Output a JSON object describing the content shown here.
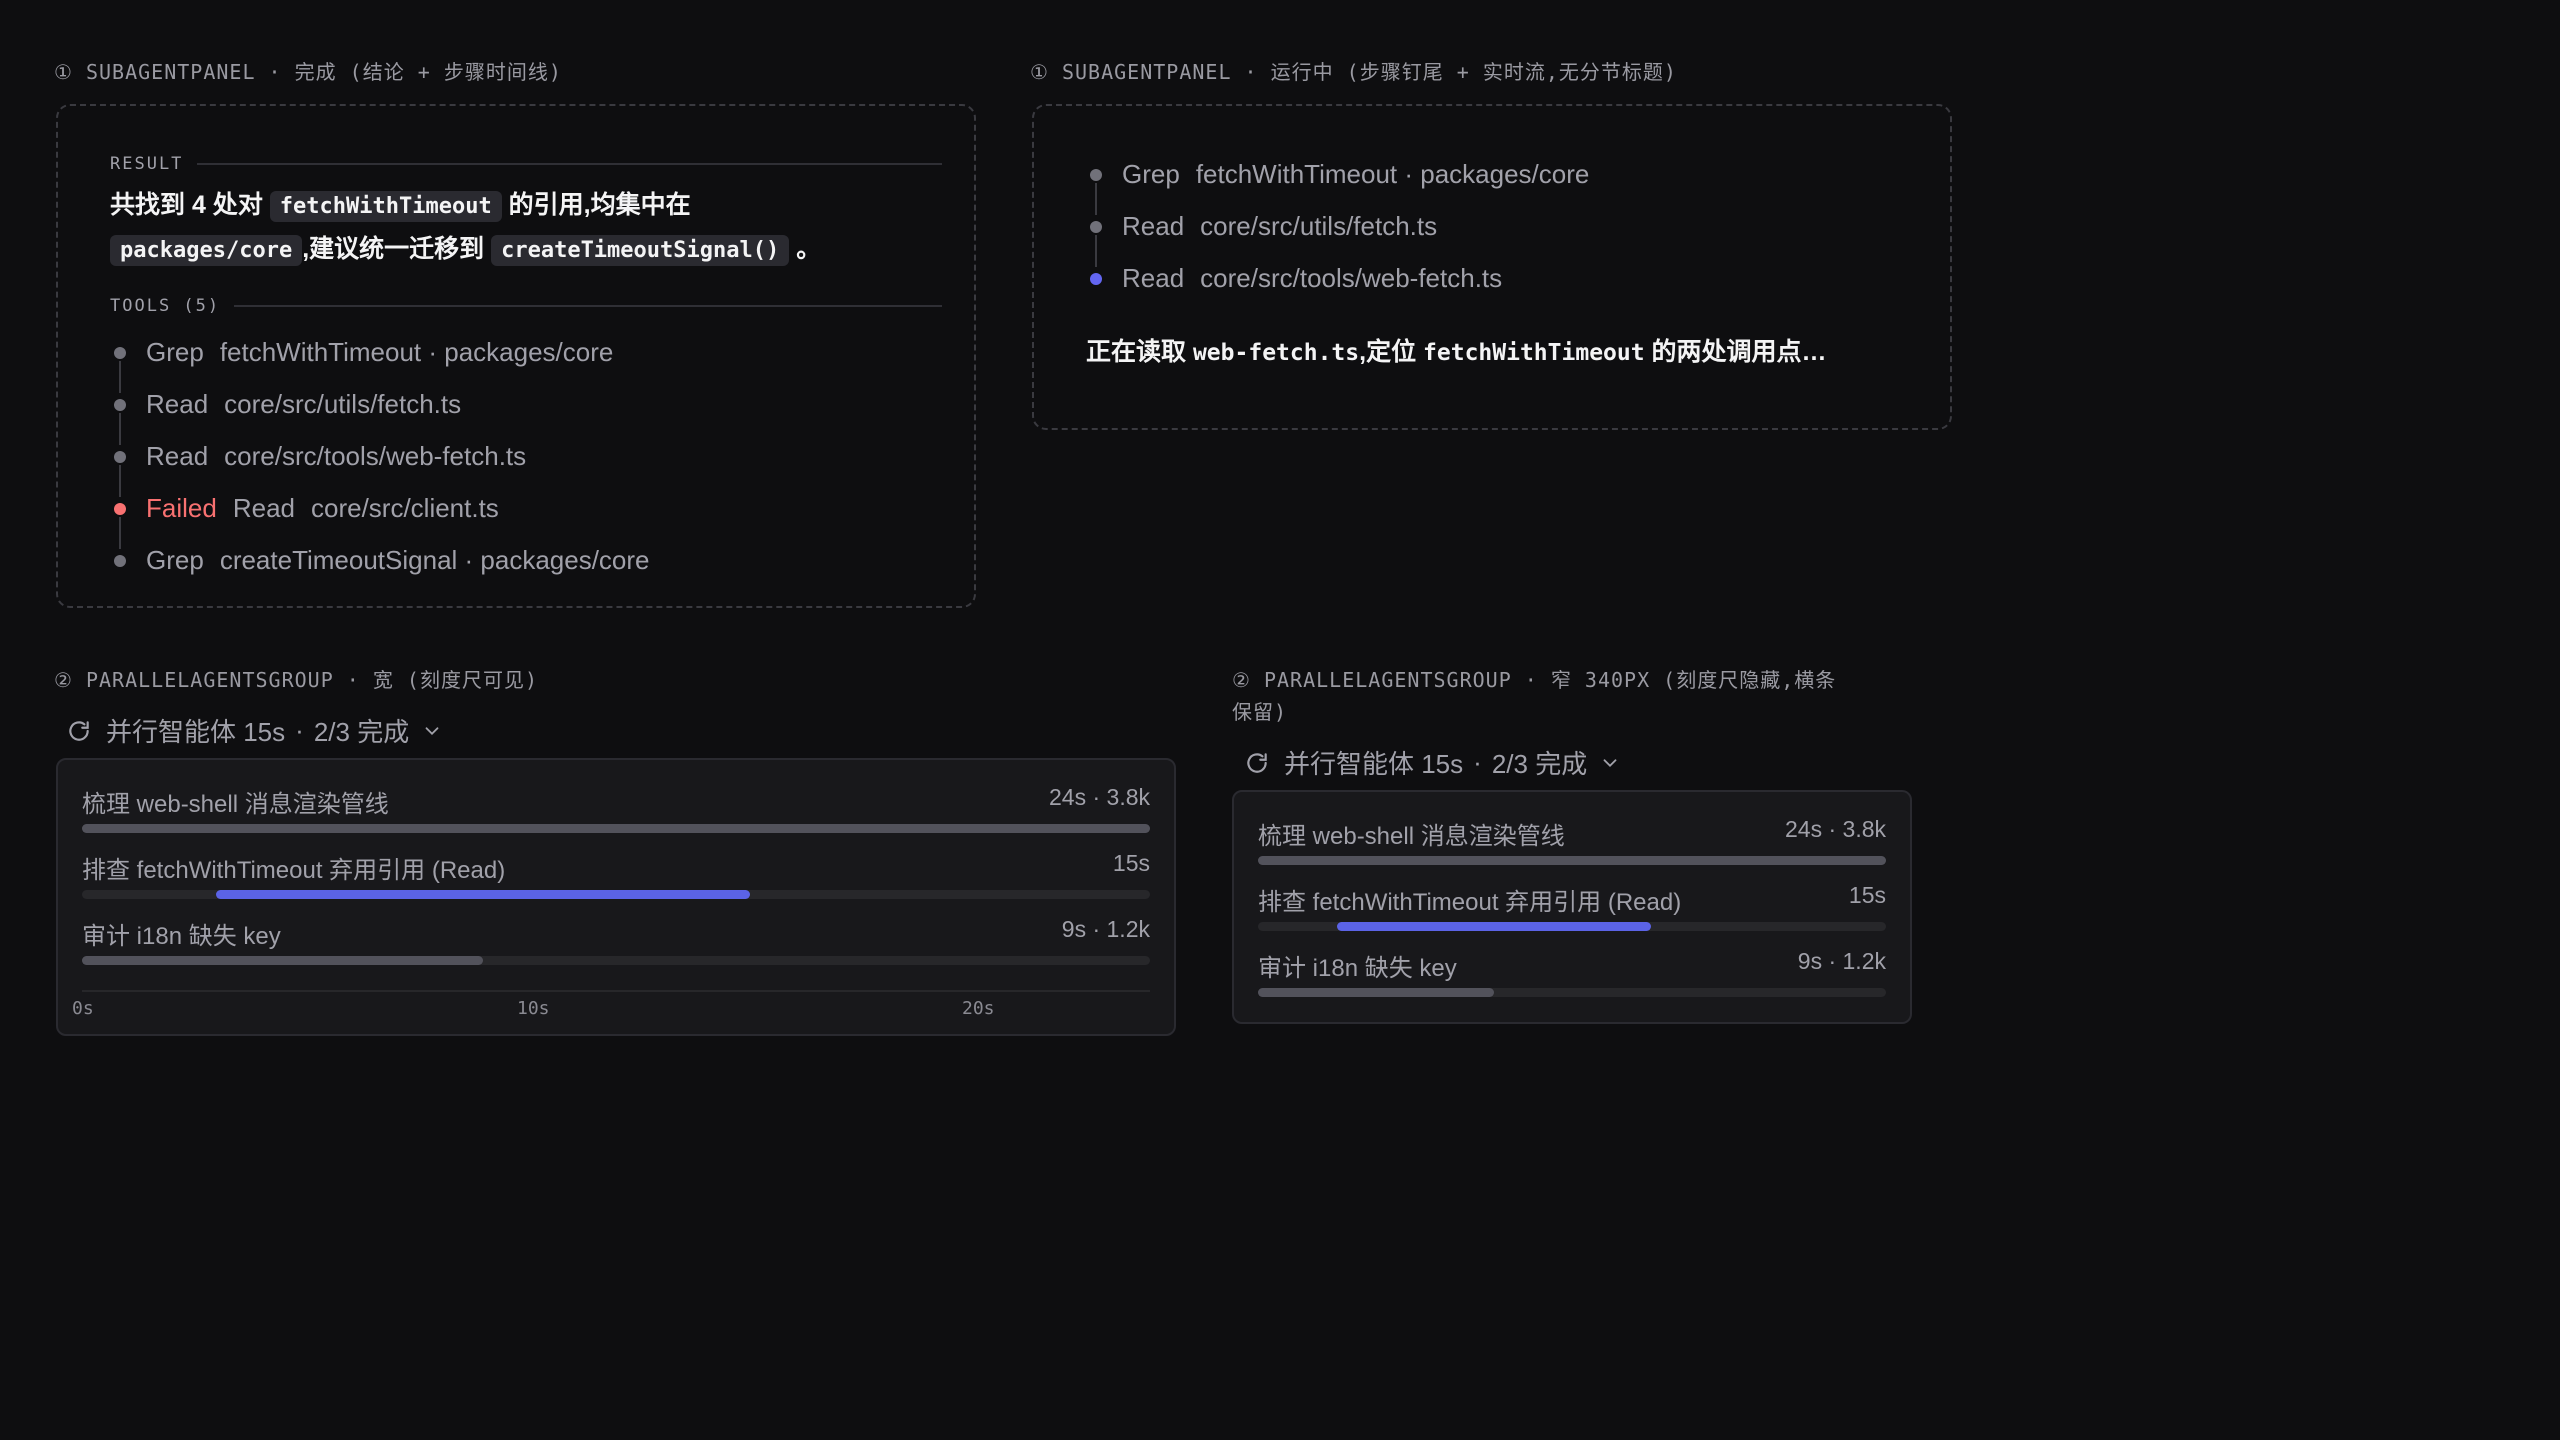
{
  "captions": {
    "panel_done": "① SUBAGENTPANEL · 完成 (结论 + 步骤时间线)",
    "panel_running": "① SUBAGENTPANEL · 运行中 (步骤钉尾 + 实时流,无分节标题)",
    "group_wide": "② PARALLELAGENTSGROUP · 宽 (刻度尺可见)",
    "group_narrow_line1": "② PARALLELAGENTSGROUP · 窄 340PX (刻度尺隐藏,横条",
    "group_narrow_line2": "保留)"
  },
  "done_panel": {
    "result_heading": "RESULT",
    "result": {
      "part1": "共找到 ",
      "count": "4 处",
      "part2": "对 ",
      "code1": "fetchWithTimeout",
      "part3": " 的引用,均集中在",
      "code2": "packages/core",
      "part4": ",建议统一迁移到 ",
      "code3": "createTimeoutSignal()",
      "part5": " 。"
    },
    "tools_heading": "TOOLS (5)",
    "tools": [
      {
        "status": "",
        "name": "Grep",
        "arg": "fetchWithTimeout · packages/core"
      },
      {
        "status": "",
        "name": "Read",
        "arg": "core/src/utils/fetch.ts"
      },
      {
        "status": "",
        "name": "Read",
        "arg": "core/src/tools/web-fetch.ts"
      },
      {
        "status": "Failed",
        "name": "Read",
        "arg": "core/src/client.ts"
      },
      {
        "status": "",
        "name": "Grep",
        "arg": "createTimeoutSignal · packages/core"
      }
    ]
  },
  "running_panel": {
    "tools": [
      {
        "name": "Grep",
        "arg": "fetchWithTimeout · packages/core"
      },
      {
        "name": "Read",
        "arg": "core/src/utils/fetch.ts"
      },
      {
        "name": "Read",
        "arg": "core/src/tools/web-fetch.ts"
      }
    ],
    "stream": {
      "part1": "正在读取 ",
      "code1": "web-fetch.ts",
      "part2": ",定位 ",
      "code2": "fetchWithTimeout",
      "part3": " 的两处调用点…"
    }
  },
  "group": {
    "title": "并行智能体 15s",
    "progress": "2/3 完成",
    "separator": "·",
    "agents": [
      {
        "label": "梳理 web-shell 消息渲染管线",
        "meta": "24s · 3.8k",
        "start": 0,
        "end": 24,
        "active": false
      },
      {
        "label": "排查 fetchWithTimeout 弃用引用 (Read)",
        "meta": "15s",
        "start": 3,
        "end": 15,
        "active": true
      },
      {
        "label": "审计 i18n 缺失 key",
        "meta": "9s · 1.2k",
        "start": 0,
        "end": 9,
        "active": false
      }
    ],
    "timeline_max": 24,
    "ticks": [
      "0s",
      "10s",
      "20s"
    ],
    "tick_values": [
      0,
      10,
      20
    ]
  },
  "colors": {
    "accent": "#5b63e6",
    "failed": "#f87171",
    "running_dot": "#6366f1"
  }
}
